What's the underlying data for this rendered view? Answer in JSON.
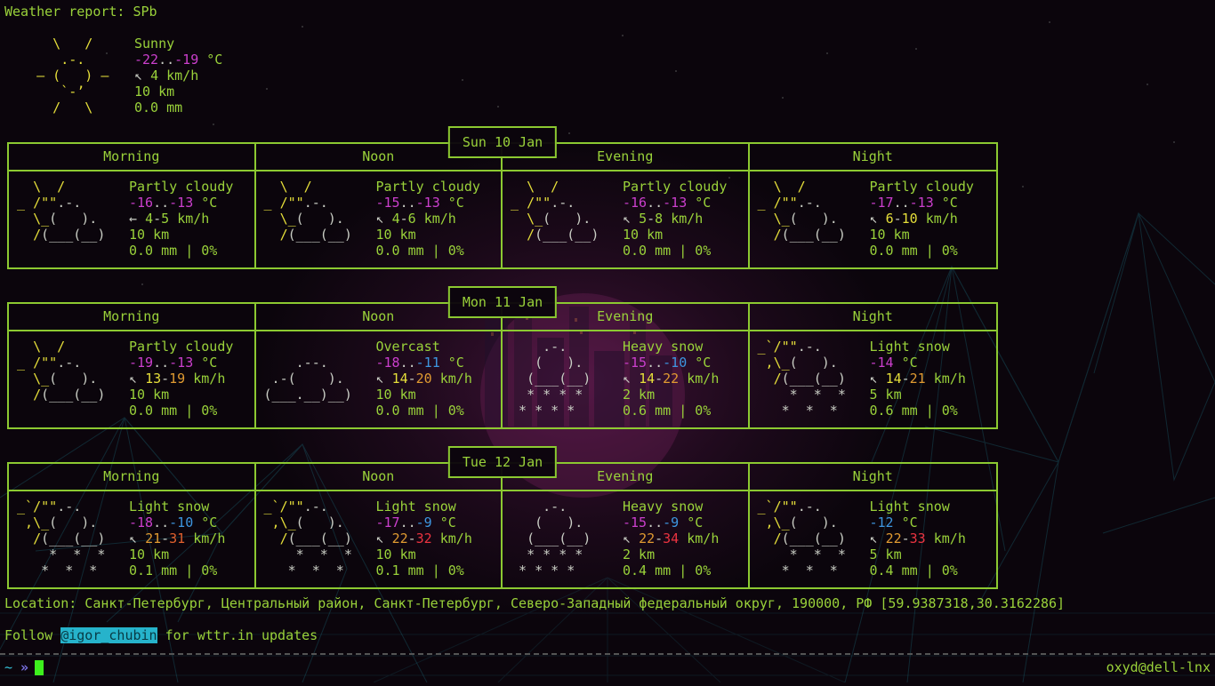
{
  "terminal": {
    "title_line": "Weather report: SPb",
    "location_line": "Location: Санкт-Петербург, Центральный район, Санкт-Петербург, Северо-Западный федеральный округ, 190000, РФ [59.9387318,30.3162286]",
    "follow": {
      "prefix": "Follow ",
      "handle": "@igor_chubin",
      "suffix": " for wttr.in updates"
    },
    "prompt": {
      "tilde": "~",
      "chevrons": "»"
    },
    "hostname": "oxyd@dell-lnx"
  },
  "colors": {
    "green": "#9ad23a",
    "yellow": "#e6df3a",
    "white": "#c9cdc4",
    "magenta": "#cb3fcd",
    "blue": "#3d96e0",
    "orange": "#e09a31",
    "redorange": "#e0602d",
    "red": "#ea3340",
    "cyan": "#26b3cb",
    "border": "#8cc931",
    "cursor": "#3df01d",
    "chevron": "#7d74e8"
  },
  "units": {
    "temp": "°C",
    "wind": "km/h"
  },
  "headers": [
    "Morning",
    "Noon",
    "Evening",
    "Night"
  ],
  "arts": {
    "sunny": [
      [
        [
          "      \\   /",
          "yellow"
        ]
      ],
      [
        [
          "       .-.",
          "yellow"
        ]
      ],
      [
        [
          "    ― (   ) ―",
          "yellow"
        ]
      ],
      [
        [
          "       `-’",
          "yellow"
        ]
      ],
      [
        [
          "      /   \\",
          "yellow"
        ]
      ]
    ],
    "partly_cloudy": [
      [
        [
          "   \\  /",
          "yellow"
        ]
      ],
      [
        [
          " _ /\"\"",
          "yellow"
        ],
        [
          ".-.",
          "white"
        ]
      ],
      [
        [
          "   \\_",
          "yellow"
        ],
        [
          "(   ).",
          "white"
        ]
      ],
      [
        [
          "   /",
          "yellow"
        ],
        [
          "(___(__)",
          "white"
        ]
      ],
      []
    ],
    "overcast": [
      [],
      [
        [
          "     .--.",
          "white"
        ]
      ],
      [
        [
          "  .-(    ).",
          "white"
        ]
      ],
      [
        [
          " (___.__)__)",
          "white"
        ]
      ],
      []
    ],
    "heavy_snow": [
      [
        [
          "     .-.",
          "white"
        ]
      ],
      [
        [
          "    (   ).",
          "white"
        ]
      ],
      [
        [
          "   (___(__)",
          "white"
        ]
      ],
      [
        [
          "   * * * *",
          "white"
        ]
      ],
      [
        [
          "  * * * *",
          "white"
        ]
      ]
    ],
    "light_snow_showers": [
      [
        [
          " _`/\"\"",
          "yellow"
        ],
        [
          ".-.",
          "white"
        ]
      ],
      [
        [
          "  ,\\_",
          "yellow"
        ],
        [
          "(   ).",
          "white"
        ]
      ],
      [
        [
          "   /",
          "yellow"
        ],
        [
          "(___(__)",
          "white"
        ]
      ],
      [
        [
          "     *  *  *",
          "white"
        ]
      ],
      [
        [
          "    *  *  *",
          "white"
        ]
      ]
    ]
  },
  "current": {
    "art": "sunny",
    "condition": "Sunny",
    "temp": [
      [
        "-22",
        "magenta"
      ],
      [
        "..",
        "white"
      ],
      [
        "-19",
        "magenta"
      ]
    ],
    "wind": {
      "arrow": "↖",
      "parts": [
        [
          "4",
          "green"
        ]
      ]
    },
    "vis": "10 km",
    "precip": "0.0 mm"
  },
  "days": [
    {
      "date": "Sun 10 Jan",
      "cells": [
        {
          "art": "partly_cloudy",
          "condition": "Partly cloudy",
          "temp": [
            [
              "-16",
              "magenta"
            ],
            [
              "..",
              "white"
            ],
            [
              "-13",
              "magenta"
            ]
          ],
          "wind": {
            "arrow": "←",
            "parts": [
              [
                "4",
                "green"
              ],
              [
                "-",
                "white"
              ],
              [
                "5",
                "green"
              ]
            ]
          },
          "vis": "10 km",
          "precip": "0.0 mm | 0%"
        },
        {
          "art": "partly_cloudy",
          "condition": "Partly cloudy",
          "temp": [
            [
              "-15",
              "magenta"
            ],
            [
              "..",
              "white"
            ],
            [
              "-13",
              "magenta"
            ]
          ],
          "wind": {
            "arrow": "↖",
            "parts": [
              [
                "4",
                "green"
              ],
              [
                "-",
                "white"
              ],
              [
                "6",
                "green"
              ]
            ]
          },
          "vis": "10 km",
          "precip": "0.0 mm | 0%"
        },
        {
          "art": "partly_cloudy",
          "condition": "Partly cloudy",
          "temp": [
            [
              "-16",
              "magenta"
            ],
            [
              "..",
              "white"
            ],
            [
              "-13",
              "magenta"
            ]
          ],
          "wind": {
            "arrow": "↖",
            "parts": [
              [
                "5",
                "green"
              ],
              [
                "-",
                "white"
              ],
              [
                "8",
                "green"
              ]
            ]
          },
          "vis": "10 km",
          "precip": "0.0 mm | 0%"
        },
        {
          "art": "partly_cloudy",
          "condition": "Partly cloudy",
          "temp": [
            [
              "-17",
              "magenta"
            ],
            [
              "..",
              "white"
            ],
            [
              "-13",
              "magenta"
            ]
          ],
          "wind": {
            "arrow": "↖",
            "parts": [
              [
                "6",
                "yellow"
              ],
              [
                "-",
                "white"
              ],
              [
                "10",
                "yellow"
              ]
            ]
          },
          "vis": "10 km",
          "precip": "0.0 mm | 0%"
        }
      ]
    },
    {
      "date": "Mon 11 Jan",
      "cells": [
        {
          "art": "partly_cloudy",
          "condition": "Partly cloudy",
          "temp": [
            [
              "-19",
              "magenta"
            ],
            [
              "..",
              "white"
            ],
            [
              "-13",
              "magenta"
            ]
          ],
          "wind": {
            "arrow": "↖",
            "parts": [
              [
                "13",
                "yellow"
              ],
              [
                "-",
                "white"
              ],
              [
                "19",
                "orange"
              ]
            ]
          },
          "vis": "10 km",
          "precip": "0.0 mm | 0%"
        },
        {
          "art": "overcast",
          "condition": "Overcast",
          "temp": [
            [
              "-18",
              "magenta"
            ],
            [
              "..",
              "white"
            ],
            [
              "-11",
              "blue"
            ]
          ],
          "wind": {
            "arrow": "↖",
            "parts": [
              [
                "14",
                "yellow"
              ],
              [
                "-",
                "white"
              ],
              [
                "20",
                "orange"
              ]
            ]
          },
          "vis": "10 km",
          "precip": "0.0 mm | 0%"
        },
        {
          "art": "heavy_snow",
          "condition": "Heavy snow",
          "temp": [
            [
              "-15",
              "magenta"
            ],
            [
              "..",
              "white"
            ],
            [
              "-10",
              "blue"
            ]
          ],
          "wind": {
            "arrow": "↖",
            "parts": [
              [
                "14",
                "yellow"
              ],
              [
                "-",
                "white"
              ],
              [
                "22",
                "orange"
              ]
            ]
          },
          "vis": "2 km",
          "precip": "0.6 mm | 0%"
        },
        {
          "art": "light_snow_showers",
          "condition": "Light snow",
          "temp": [
            [
              "-14",
              "magenta"
            ]
          ],
          "wind": {
            "arrow": "↖",
            "parts": [
              [
                "14",
                "yellow"
              ],
              [
                "-",
                "white"
              ],
              [
                "21",
                "orange"
              ]
            ]
          },
          "vis": "5 km",
          "precip": "0.6 mm | 0%"
        }
      ]
    },
    {
      "date": "Tue 12 Jan",
      "cells": [
        {
          "art": "light_snow_showers",
          "condition": "Light snow",
          "temp": [
            [
              "-18",
              "magenta"
            ],
            [
              "..",
              "white"
            ],
            [
              "-10",
              "blue"
            ]
          ],
          "wind": {
            "arrow": "↖",
            "parts": [
              [
                "21",
                "orange"
              ],
              [
                "-",
                "white"
              ],
              [
                "31",
                "redorange"
              ]
            ]
          },
          "vis": "10 km",
          "precip": "0.1 mm | 0%"
        },
        {
          "art": "light_snow_showers",
          "condition": "Light snow",
          "temp": [
            [
              "-17",
              "magenta"
            ],
            [
              "..",
              "white"
            ],
            [
              "-9",
              "blue"
            ]
          ],
          "wind": {
            "arrow": "↖",
            "parts": [
              [
                "22",
                "orange"
              ],
              [
                "-",
                "white"
              ],
              [
                "32",
                "red"
              ]
            ]
          },
          "vis": "10 km",
          "precip": "0.1 mm | 0%"
        },
        {
          "art": "heavy_snow",
          "condition": "Heavy snow",
          "temp": [
            [
              "-15",
              "magenta"
            ],
            [
              "..",
              "white"
            ],
            [
              "-9",
              "blue"
            ]
          ],
          "wind": {
            "arrow": "↖",
            "parts": [
              [
                "22",
                "orange"
              ],
              [
                "-",
                "white"
              ],
              [
                "34",
                "red"
              ]
            ]
          },
          "vis": "2 km",
          "precip": "0.4 mm | 0%"
        },
        {
          "art": "light_snow_showers",
          "condition": "Light snow",
          "temp": [
            [
              "-12",
              "blue"
            ]
          ],
          "wind": {
            "arrow": "↖",
            "parts": [
              [
                "22",
                "orange"
              ],
              [
                "-",
                "white"
              ],
              [
                "33",
                "red"
              ]
            ]
          },
          "vis": "5 km",
          "precip": "0.4 mm | 0%"
        }
      ]
    }
  ]
}
